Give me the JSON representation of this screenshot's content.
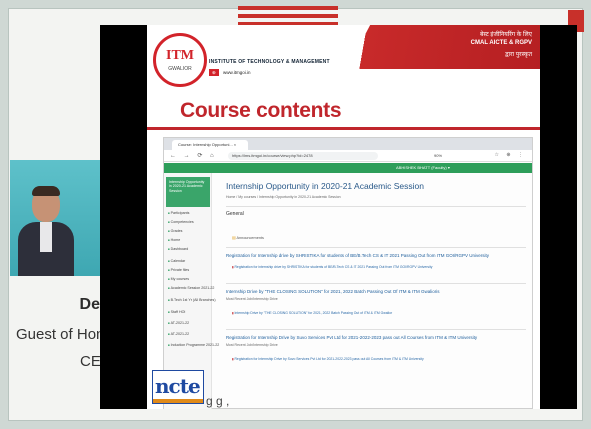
{
  "header": {
    "institute_name": "INSTITUTE OF TECHNOLOGY & MANAGEMENT",
    "logo_text": "ITM",
    "logo_subtext": "GWALIOR",
    "website_badge": "⊕",
    "website": "www.itmgoi.in",
    "ribbon_line1": "बेस्ट इंजीनियरिंग के लिए",
    "ribbon_line2": "CMAL AICTE & RGPV",
    "ribbon_line3": "द्वारा पुरस्कृत"
  },
  "slide": {
    "title": "Course contents"
  },
  "speaker": {
    "name": "De",
    "role_line1": "Guest of Hon",
    "role_line2": "CE"
  },
  "browser": {
    "tab_label": "Course: Internship Opportuni... ×",
    "nav_icons": "← → ⟳ ⌂",
    "url": "https://lms.itmgoi.in/course/view.php?id=2478",
    "zoom": "90%",
    "toolbar_icons": "☆ ⊕ ⋮",
    "user_label": "ABHISHEK BHATT (Faculty) ▾"
  },
  "course_page": {
    "sidebar_active": "Internship Opportunity in 2020-21 Academic Session",
    "sidebar_items": [
      "Participants",
      "Competencies",
      "Grades",
      "Home",
      "Dashboard",
      "Calendar",
      "Private files",
      "My courses",
      "Academic Session 2021-22",
      "B.Tech 1st Yr (All Branches)",
      "Staff HOI",
      "AT-2021-22",
      "AT-2021-22",
      "Induction Programme 2021-22"
    ],
    "page_title": "Internship Opportunity in 2020-21 Academic Session",
    "breadcrumbs": "Home / My courses / Internship Opportunity in 2020-21 Academic Session",
    "section": "General",
    "announcements": "Announcements",
    "entries": [
      {
        "title": "Registration for Internship drive by SHRISTIKA for students of BE/B.Tech CS & IT 2021 Passing Out from ITM GOI/RGPV University",
        "sub": "",
        "link": "Registration for internship drive by SHRISTIKA for students of BE/B.Tech CS & IT 2021 Passing Out from ITM GOI/RGPV University"
      },
      {
        "title": "Internship Drive by \"THE CLOSING SOLUTION\" for 2021, 2022 Batch Passing Out Of ITM & ITM Gwalioris",
        "sub": "Most Recent Job/Internship Drive",
        "link": "Internship Drive by \"THE CLOSING SOLUTION\" for 2021, 2022 Batch Passing Out of ITM & ITM Gwalior"
      },
      {
        "title": "Registration for Internship Drive by Suvo Services Pvt Ltd for 2021-2022-2023 pass out All Courses from ITM & ITM University",
        "sub": "Most Recent Job/Internship Drive",
        "link": "Registration for Internship Drive by Suvo Services Pvt Ltd for 2021-2022-2023 pass out All Courses from ITM & ITM University"
      }
    ]
  },
  "footer": {
    "logo_text": "ncte",
    "caption": "g  g  ,"
  },
  "colors": {
    "brand_red": "#c0262c",
    "moodle_green": "#2e9e5a",
    "link_blue": "#1b5c9a"
  }
}
